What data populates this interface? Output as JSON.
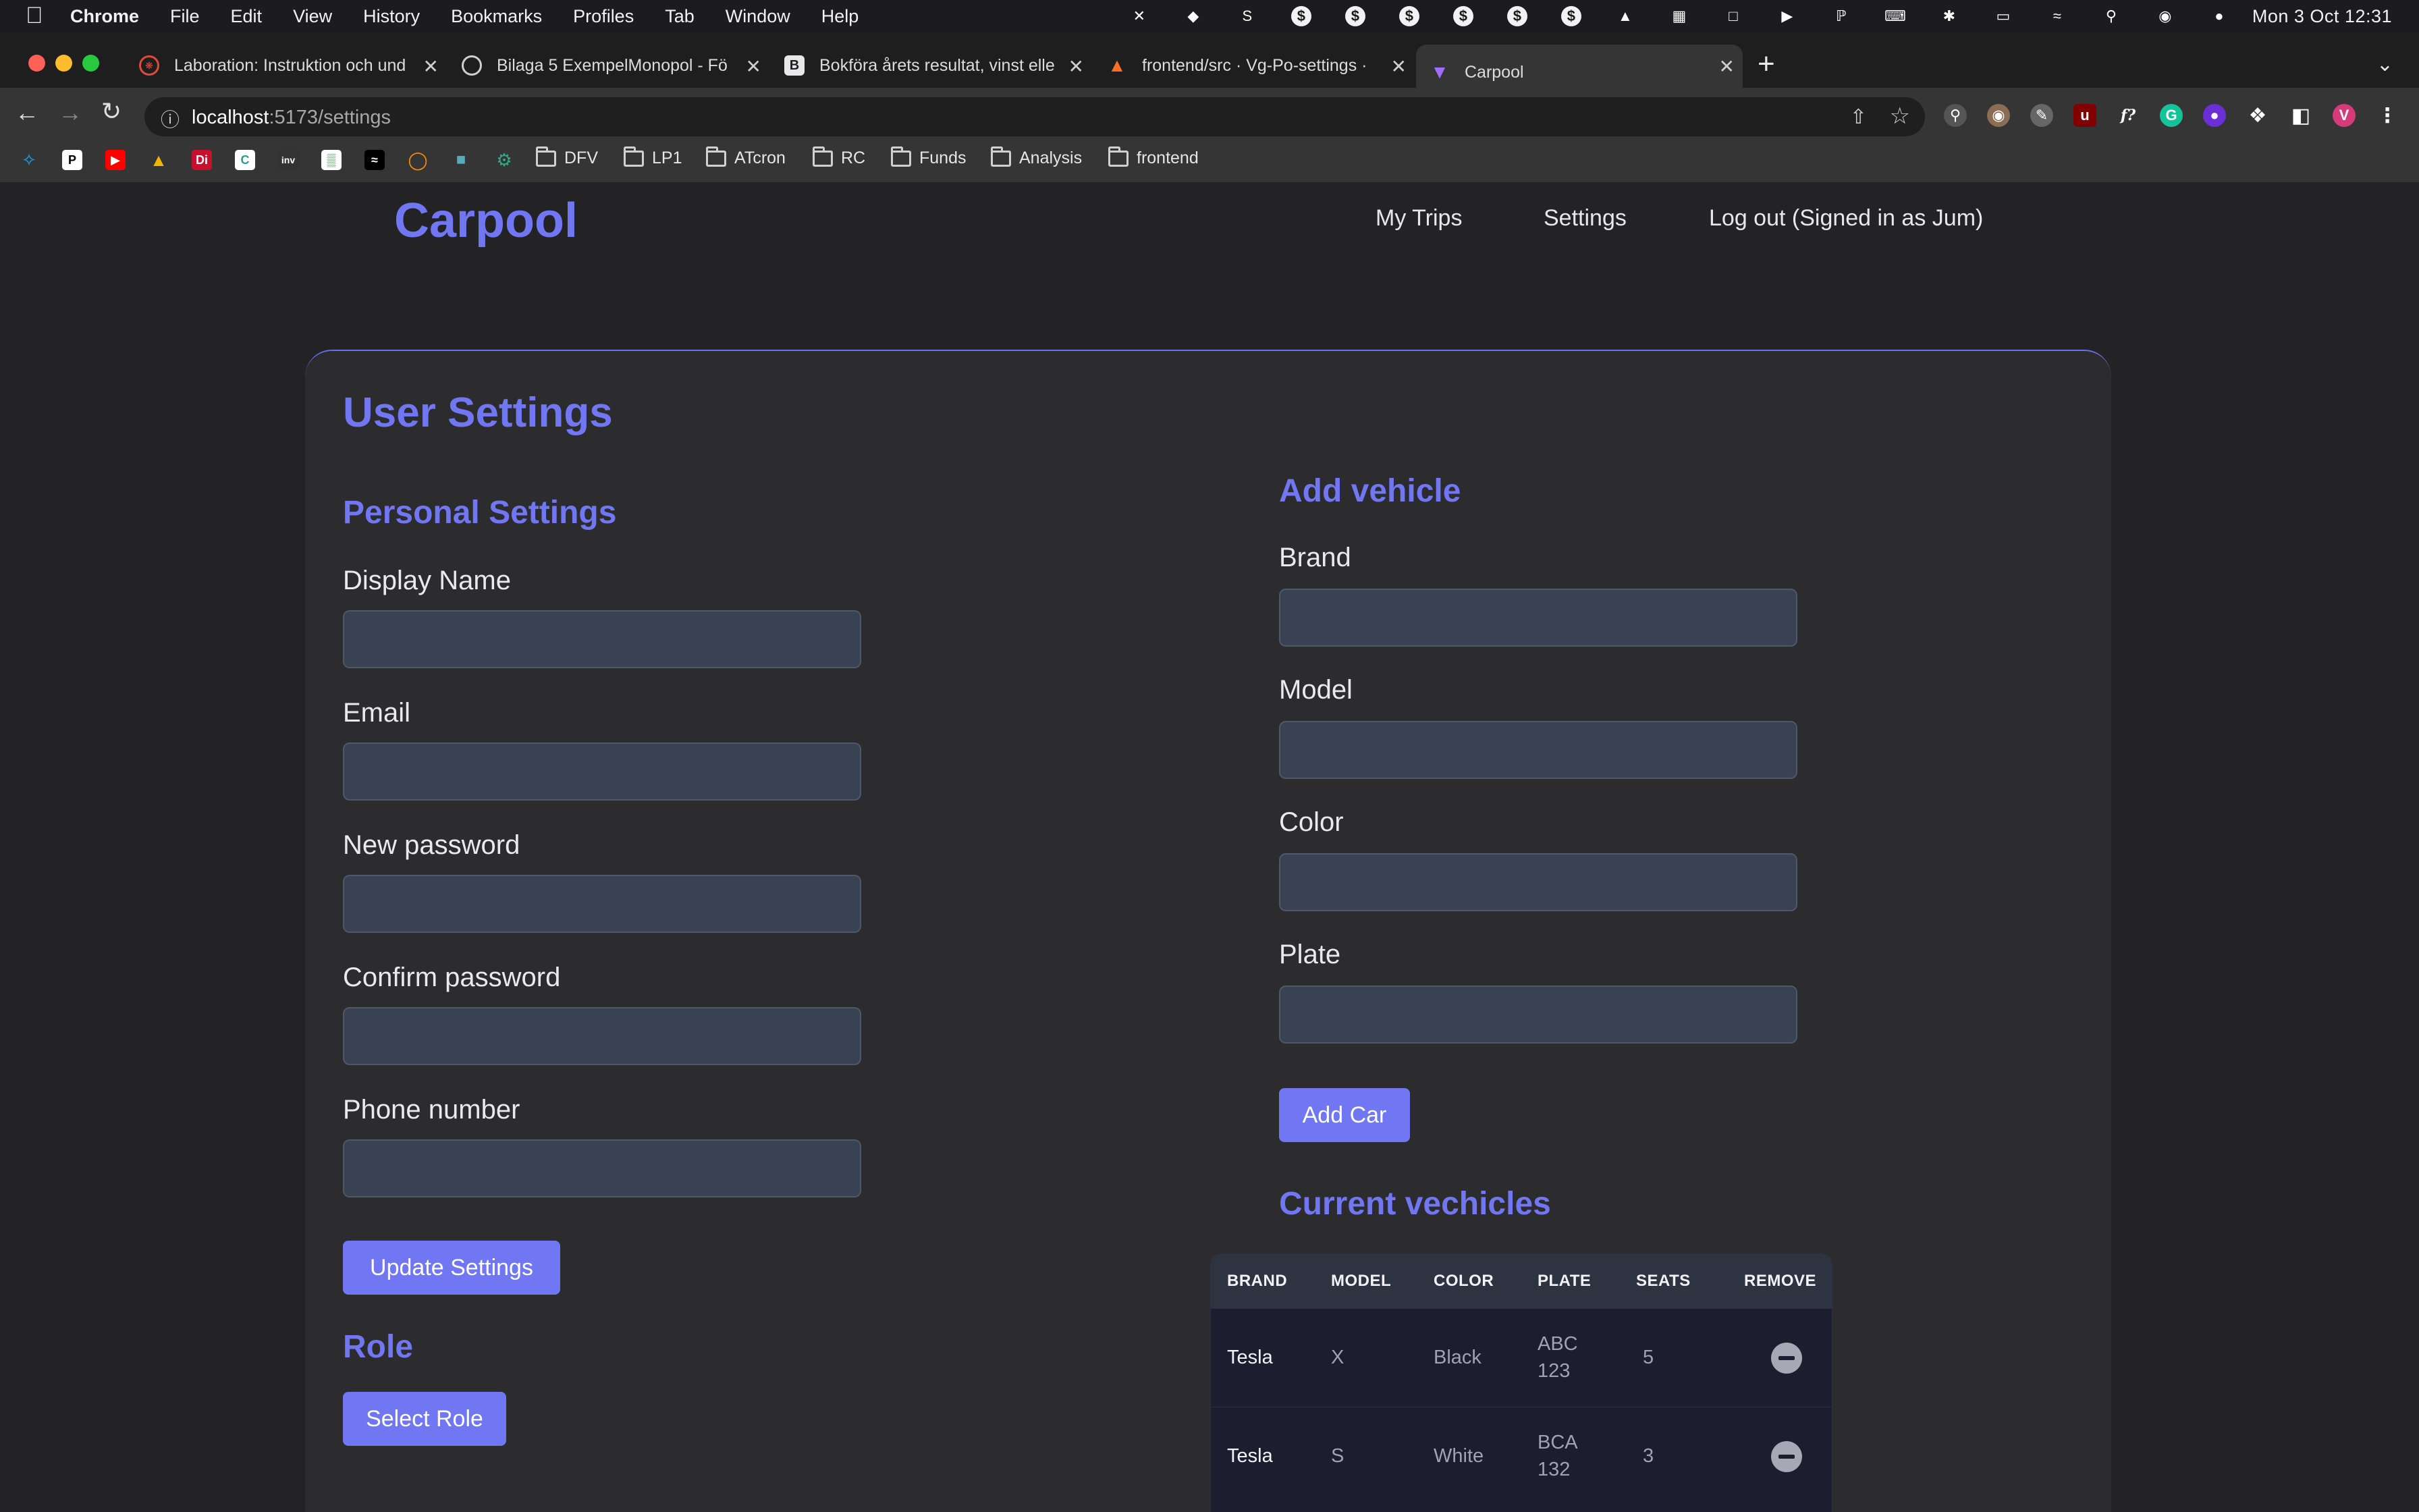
{
  "menubar": {
    "app_name": "Chrome",
    "menus": [
      "File",
      "Edit",
      "View",
      "History",
      "Bookmarks",
      "Profiles",
      "Tab",
      "Window",
      "Help"
    ],
    "clock": "Mon 3 Oct  12:31"
  },
  "browser": {
    "tabs": [
      {
        "title": "Laboration: Instruktion och und"
      },
      {
        "title": "Bilaga 5 ExempelMonopol - Fö"
      },
      {
        "title": "Bokföra årets resultat, vinst elle"
      },
      {
        "title": "frontend/src · Vg-Po-settings ·"
      },
      {
        "title": "Carpool"
      }
    ],
    "url_host": "localhost",
    "url_path": ":5173/settings",
    "bookmark_folders": [
      "DFV",
      "LP1",
      "ATcron",
      "RC",
      "Funds",
      "Analysis",
      "frontend"
    ],
    "profile_initial": "V"
  },
  "site": {
    "brand": "Carpool",
    "nav": {
      "trips": "My Trips",
      "settings": "Settings",
      "logout": "Log out (Signed in as Jum)"
    }
  },
  "settings": {
    "title": "User Settings",
    "personal": {
      "heading": "Personal Settings",
      "display_name": {
        "label": "Display Name",
        "value": ""
      },
      "email": {
        "label": "Email",
        "value": ""
      },
      "new_password": {
        "label": "New password",
        "value": ""
      },
      "confirm_password": {
        "label": "Confirm password",
        "value": ""
      },
      "phone": {
        "label": "Phone number",
        "value": ""
      },
      "update_button": "Update Settings"
    },
    "role": {
      "heading": "Role",
      "select_button": "Select Role"
    },
    "vehicle": {
      "heading": "Add vehicle",
      "brand": {
        "label": "Brand",
        "value": ""
      },
      "model": {
        "label": "Model",
        "value": ""
      },
      "color": {
        "label": "Color",
        "value": ""
      },
      "plate": {
        "label": "Plate",
        "value": ""
      },
      "add_button": "Add Car"
    },
    "current": {
      "heading": "Current vechicles",
      "columns": [
        "BRAND",
        "MODEL",
        "COLOR",
        "PLATE",
        "SEATS",
        "REMOVE"
      ],
      "rows": [
        {
          "brand": "Tesla",
          "model": "X",
          "color": "Black",
          "plate_1": "ABC",
          "plate_2": "123",
          "seats": "5"
        },
        {
          "brand": "Tesla",
          "model": "S",
          "color": "White",
          "plate_1": "BCA",
          "plate_2": "132",
          "seats": "3"
        }
      ]
    }
  },
  "colors": {
    "accent": "#7177f2",
    "background": "#232325",
    "card": "#2c2c2e",
    "input": "#384252"
  }
}
